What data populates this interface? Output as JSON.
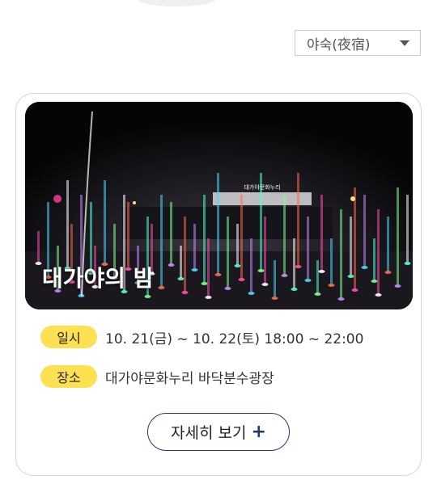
{
  "filter": {
    "selected": "야숙(夜宿)"
  },
  "event": {
    "image_title": "대가야의 밤",
    "building_sign": "대가야문화누리",
    "date_label": "일시",
    "date_value": "10. 21(금) ~ 10. 22(토) 18:00 ~ 22:00",
    "place_label": "장소",
    "place_value": "대가야문화누리 바닥분수광장",
    "more_button": "자세히 보기",
    "more_icon": "+"
  },
  "colors": {
    "pill": "#fde150",
    "button_border": "#1f3a6e"
  }
}
